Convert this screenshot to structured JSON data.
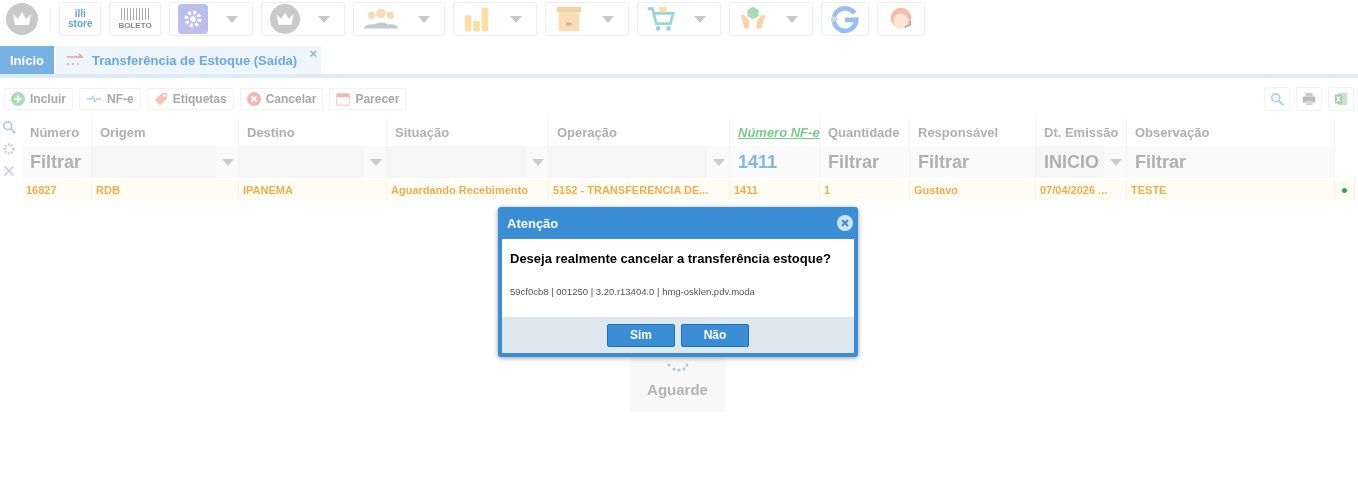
{
  "toolbar": [
    {
      "kind": "crown",
      "framed": false,
      "dropdown": false
    },
    {
      "kind": "store",
      "framed": true,
      "label": "illi",
      "sublabel": "store",
      "dropdown": false
    },
    {
      "kind": "boleto",
      "framed": true,
      "label": "BOLETO",
      "dropdown": false
    },
    {
      "kind": "gear",
      "framed": true,
      "dropdown": true
    },
    {
      "kind": "crown",
      "framed": true,
      "dropdown": true
    },
    {
      "kind": "people",
      "framed": true,
      "dropdown": true
    },
    {
      "kind": "bars",
      "framed": true,
      "dropdown": true
    },
    {
      "kind": "box",
      "framed": true,
      "dropdown": true
    },
    {
      "kind": "cart",
      "framed": true,
      "dropdown": true
    },
    {
      "kind": "hands",
      "framed": true,
      "dropdown": true
    },
    {
      "kind": "g",
      "framed": true,
      "dropdown": false
    },
    {
      "kind": "support",
      "framed": true,
      "dropdown": false
    }
  ],
  "tabs": [
    {
      "kind": "home",
      "label": "Início",
      "selected": true,
      "closable": false
    },
    {
      "kind": "transfer",
      "label": "Transferência de Estoque (Saída)",
      "selected": false,
      "closable": true,
      "close": "×"
    }
  ],
  "actions": [
    {
      "kind": "plus",
      "label": "Incluir"
    },
    {
      "kind": "nfe",
      "label": "NF-e"
    },
    {
      "kind": "tag",
      "label": "Etiquetas"
    },
    {
      "kind": "cancel",
      "label": "Cancelar"
    },
    {
      "kind": "calendar",
      "label": "Parecer"
    }
  ],
  "right_tools": [
    {
      "kind": "search"
    },
    {
      "kind": "print"
    },
    {
      "kind": "excel"
    }
  ],
  "side_tools": [
    {
      "kind": "search"
    },
    {
      "kind": "gear"
    },
    {
      "kind": "close"
    }
  ],
  "table": {
    "columns": [
      {
        "label": "Número",
        "sorted": false,
        "filter": {
          "kind": "text",
          "placeholder": "Filtrar"
        }
      },
      {
        "label": "Origem",
        "sorted": false,
        "filter": {
          "kind": "select"
        }
      },
      {
        "label": "Destino",
        "sorted": false,
        "filter": {
          "kind": "select"
        }
      },
      {
        "label": "Situação",
        "sorted": false,
        "filter": {
          "kind": "select"
        }
      },
      {
        "label": "Operação",
        "sorted": false,
        "filter": {
          "kind": "select"
        }
      },
      {
        "label": "Número NF-e",
        "sorted": true,
        "filter": {
          "kind": "text",
          "value": "1411"
        }
      },
      {
        "label": "Quantidade",
        "sorted": false,
        "filter": {
          "kind": "text",
          "placeholder": "Filtrar"
        }
      },
      {
        "label": "Responsável",
        "sorted": false,
        "filter": {
          "kind": "text",
          "placeholder": "Filtrar"
        }
      },
      {
        "label": "Dt. Emissão",
        "sorted": false,
        "filter": {
          "kind": "select",
          "value": "INICIO"
        }
      },
      {
        "label": "Observação",
        "sorted": false,
        "filter": {
          "kind": "text",
          "placeholder": "Filtrar"
        }
      }
    ],
    "rows": [
      {
        "cells": [
          "16827",
          "RDB",
          "IPANEMA",
          "Aguardando Recebimento",
          "5152 - TRANSFERENCIA DE...",
          "1411",
          "1",
          "Gustavo",
          "07/04/2026 ...",
          "TESTE"
        ]
      }
    ]
  },
  "loading": {
    "label": "Aguarde"
  },
  "dialog": {
    "title": "Atenção",
    "message": "Deseja realmente cancelar a transferência estoque?",
    "info": "59cf0cb8 | 001250 | 3.20.r13404.0 | hmg-osklen.pdv.moda",
    "buttons": [
      "Sim",
      "Não"
    ]
  }
}
